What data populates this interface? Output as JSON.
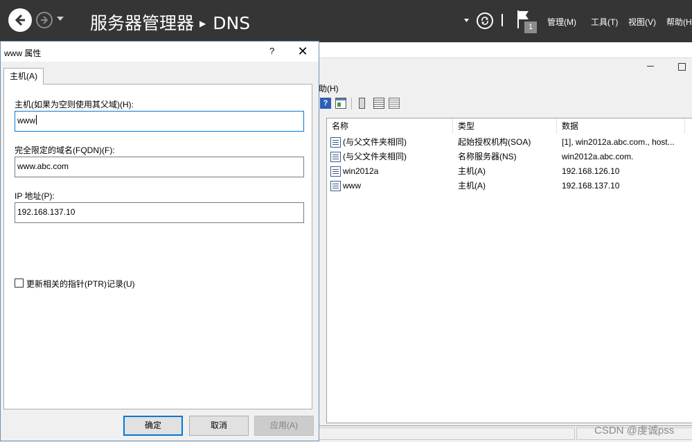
{
  "topbar": {
    "breadcrumb_app": "服务器管理器",
    "breadcrumb_page": "DNS",
    "notification_count": "1",
    "menus": [
      "管理(M)",
      "工具(T)",
      "视图(V)",
      "帮助(H"
    ]
  },
  "console": {
    "help_menu": "助(H)",
    "columns": [
      "名称",
      "类型",
      "数据"
    ],
    "records": [
      {
        "name": "(与父文件夹相同)",
        "type": "起始授权机构(SOA)",
        "data": "[1], win2012a.abc.com., host..."
      },
      {
        "name": "(与父文件夹相同)",
        "type": "名称服务器(NS)",
        "data": "win2012a.abc.com."
      },
      {
        "name": "win2012a",
        "type": "主机(A)",
        "data": "192.168.126.10"
      },
      {
        "name": "www",
        "type": "主机(A)",
        "data": "192.168.137.10"
      }
    ]
  },
  "dialog": {
    "title": "www 属性",
    "help": "?",
    "close": "✕",
    "tab": "主机(A)",
    "host_label": "主机(如果为空则使用其父域)(H):",
    "host_value": "www",
    "fqdn_label": "完全限定的域名(FQDN)(F):",
    "fqdn_value": "www.abc.com",
    "ip_label": "IP 地址(P):",
    "ip_value": "192.168.137.10",
    "ptr_label": "更新相关的指针(PTR)记录(U)",
    "ptr_checked": false,
    "ok": "确定",
    "cancel": "取消",
    "apply": "应用(A)"
  },
  "watermark": "CSDN @虔诚pss",
  "colors": {
    "topbar": "#353535",
    "focus": "#0078d7"
  }
}
